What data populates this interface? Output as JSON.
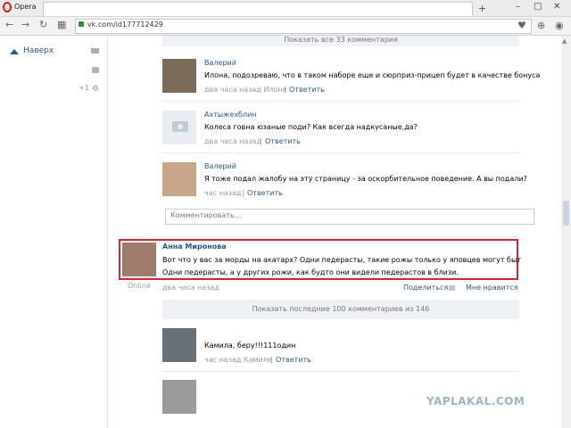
{
  "browser": {
    "app_label": "Opera",
    "url": "vk.com/id177712429",
    "new_tab": "+",
    "win_buttons": [
      "–",
      "□",
      "✕"
    ]
  },
  "sidebar": {
    "page_top": "Наверх",
    "counter": "+1"
  },
  "comments": {
    "show_all": "Показать все 33 комментария",
    "items": [
      {
        "author": "Валерий",
        "text": "Илона, подозреваю, что в таком наборе еще и сюрприз-прицеп будет в качестве бонуса",
        "time": "два часа назад Илоне",
        "reply": "Ответить"
      },
      {
        "author": "Ахтыжехблин",
        "text": "Колеса говна юзаные поди? Как всегда надкусаные,да?",
        "time": "два часа назад",
        "reply": "Ответить"
      },
      {
        "author": "Валерий",
        "text": "Я тоже подал жалобу на эту страницу - за оскорбительное поведение. А вы подали?",
        "time": "час назад",
        "reply": "Ответить"
      }
    ],
    "input_placeholder": "Комментировать..."
  },
  "post": {
    "author": "Анна Миронова",
    "line1": "Вот что у вас за морды на акатарх? Одни педерасты, такие рожы только у яповцев могут быт",
    "line2": "Одни педерасты, а у других рожи, как будто они видели педерастов в близи.",
    "online": "Online",
    "time": "два часа назад",
    "share": "Поделиться",
    "like": "Мне нравится"
  },
  "comments2": {
    "show_last": "Показать последние 100 комментариев из 146",
    "items": [
      {
        "text": "Камила, беру!!!111один",
        "time": "час назад Камиле",
        "reply": "Ответить"
      }
    ]
  },
  "watermark": "YAPLAKAL.COM"
}
